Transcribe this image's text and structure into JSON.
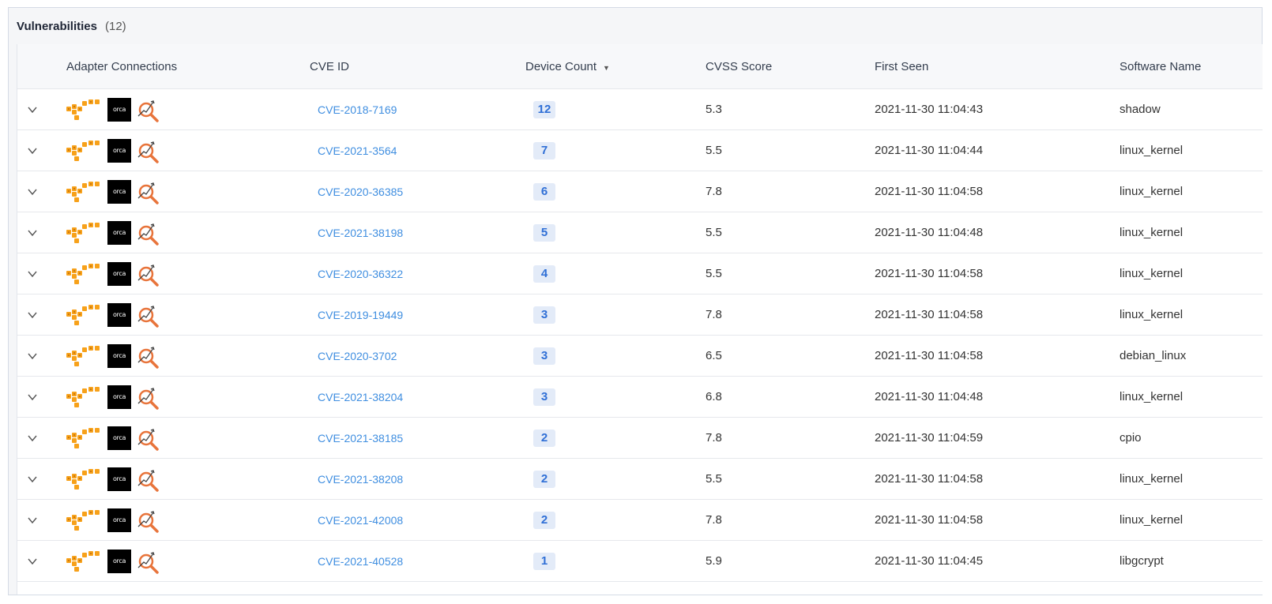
{
  "panel": {
    "title": "Vulnerabilities",
    "count": "(12)"
  },
  "columns": {
    "adapter": "Adapter Connections",
    "cve": "CVE ID",
    "device": "Device Count",
    "cvss": "CVSS Score",
    "seen": "First Seen",
    "software": "Software Name"
  },
  "icons": {
    "orca_text": "orca",
    "expand": "chevron-down-icon"
  },
  "colors": {
    "link": "#3f8ee0",
    "badge_bg": "#e3ebf8",
    "badge_fg": "#2f6fd6",
    "aws_orange": "#f7a11a",
    "scan_orange": "#e8743b"
  },
  "rows": [
    {
      "cve": "CVE-2018-7169",
      "device": "12",
      "cvss": "5.3",
      "seen": "2021-11-30 11:04:43",
      "software": "shadow"
    },
    {
      "cve": "CVE-2021-3564",
      "device": "7",
      "cvss": "5.5",
      "seen": "2021-11-30 11:04:44",
      "software": "linux_kernel"
    },
    {
      "cve": "CVE-2020-36385",
      "device": "6",
      "cvss": "7.8",
      "seen": "2021-11-30 11:04:58",
      "software": "linux_kernel"
    },
    {
      "cve": "CVE-2021-38198",
      "device": "5",
      "cvss": "5.5",
      "seen": "2021-11-30 11:04:48",
      "software": "linux_kernel"
    },
    {
      "cve": "CVE-2020-36322",
      "device": "4",
      "cvss": "5.5",
      "seen": "2021-11-30 11:04:58",
      "software": "linux_kernel"
    },
    {
      "cve": "CVE-2019-19449",
      "device": "3",
      "cvss": "7.8",
      "seen": "2021-11-30 11:04:58",
      "software": "linux_kernel"
    },
    {
      "cve": "CVE-2020-3702",
      "device": "3",
      "cvss": "6.5",
      "seen": "2021-11-30 11:04:58",
      "software": "debian_linux"
    },
    {
      "cve": "CVE-2021-38204",
      "device": "3",
      "cvss": "6.8",
      "seen": "2021-11-30 11:04:48",
      "software": "linux_kernel"
    },
    {
      "cve": "CVE-2021-38185",
      "device": "2",
      "cvss": "7.8",
      "seen": "2021-11-30 11:04:59",
      "software": "cpio"
    },
    {
      "cve": "CVE-2021-38208",
      "device": "2",
      "cvss": "5.5",
      "seen": "2021-11-30 11:04:58",
      "software": "linux_kernel"
    },
    {
      "cve": "CVE-2021-42008",
      "device": "2",
      "cvss": "7.8",
      "seen": "2021-11-30 11:04:58",
      "software": "linux_kernel"
    },
    {
      "cve": "CVE-2021-40528",
      "device": "1",
      "cvss": "5.9",
      "seen": "2021-11-30 11:04:45",
      "software": "libgcrypt"
    }
  ]
}
